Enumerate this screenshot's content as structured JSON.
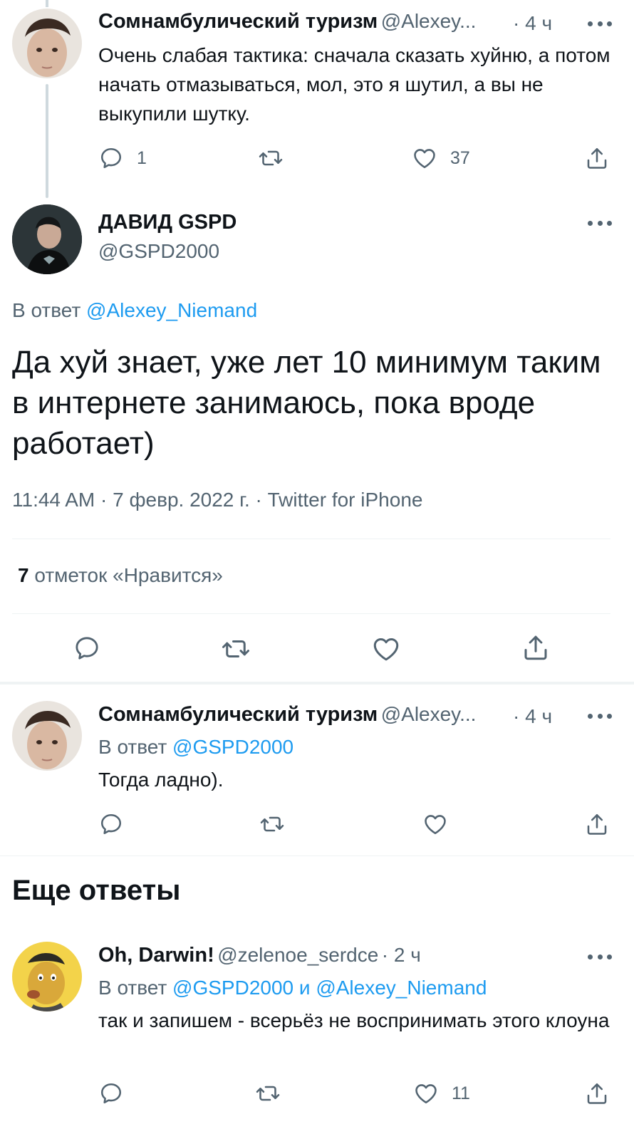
{
  "tweet1": {
    "name": "Сомнамбулический туризм",
    "handle": "@Alexey...",
    "time": "· 4 ч",
    "text": "Очень слабая тактика: сначала сказать хуйню, а потом начать отмазываться, мол, это я шутил, а вы не выкупили шутку.",
    "replies": "1",
    "likes": "37"
  },
  "main_tweet": {
    "name": "ДАВИД GSPD",
    "handle": "@GSPD2000",
    "reply_prefix": "В ответ ",
    "reply_to": "@Alexey_Niemand",
    "text": "Да хуй знает, уже лет 10 минимум таким в интернете занимаюсь, пока вроде работает)",
    "timestamp": "11:44 AM · 7 февр. 2022 г. · Twitter for iPhone",
    "likes_count": "7",
    "likes_label": " отметок «Нравится»"
  },
  "tweet2": {
    "name": "Сомнамбулический туризм",
    "handle": "@Alexey...",
    "time": "· 4 ч",
    "reply_prefix": "В ответ ",
    "reply_to": "@GSPD2000",
    "text": "Тогда ладно)."
  },
  "more_replies": {
    "title": "Еще ответы"
  },
  "tweet3": {
    "name": "Oh, Darwin!",
    "handle": "@zelenoe_serdce",
    "time": "· 2 ч",
    "reply_prefix": "В ответ ",
    "reply_to_1": "@GSPD2000",
    "reply_joiner": " и ",
    "reply_to_2": "@Alexey_Niemand",
    "text": "так и запишем - всерьёз не воспринимать этого клоуна",
    "likes": "11"
  },
  "icons": {
    "reply": "reply-icon",
    "retweet": "retweet-icon",
    "like": "like-icon",
    "share": "share-icon",
    "more": "more-icon"
  },
  "colors": {
    "text": "#0f1419",
    "secondary": "#536471",
    "link": "#1d9bf0",
    "divider": "#eff3f4"
  }
}
